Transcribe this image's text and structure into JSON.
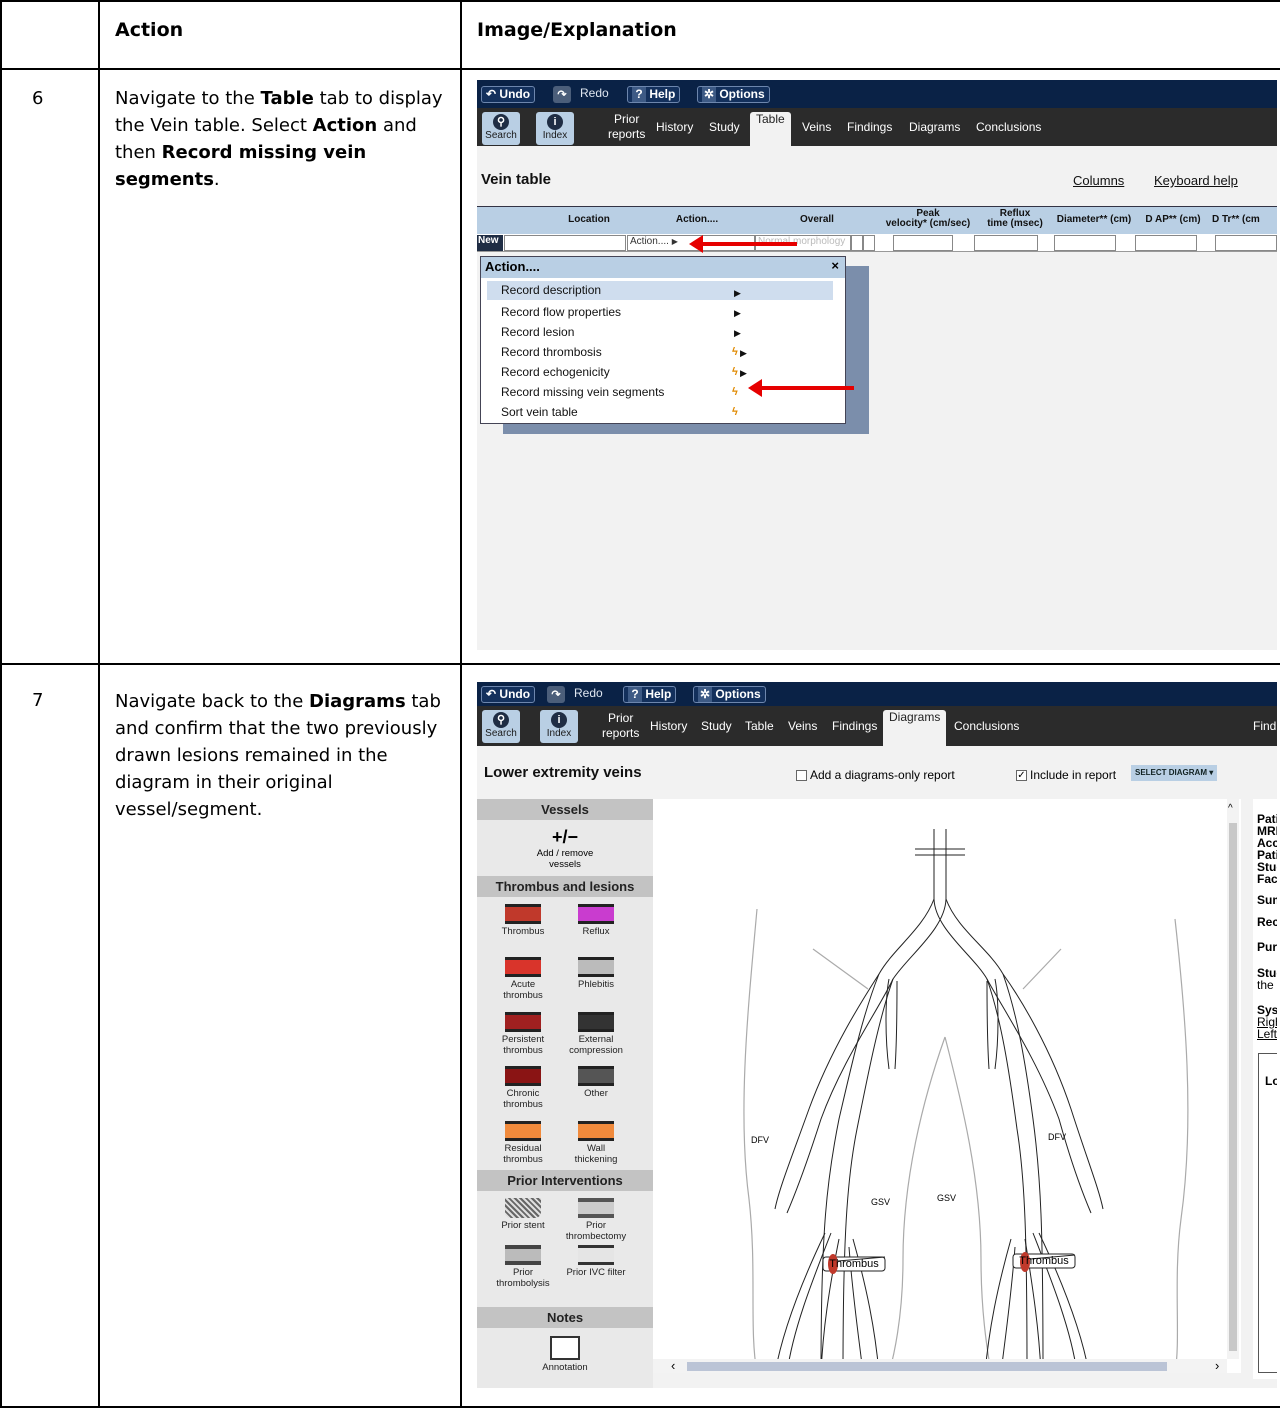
{
  "table_header": {
    "col_action": "Action",
    "col_image": "Image/Explanation"
  },
  "steps": [
    {
      "number": "6",
      "description_parts": [
        "Navigate to the ",
        "Table",
        " tab to display the Vein table. Select ",
        "Action",
        " and then ",
        "Record missing vein segments",
        "."
      ]
    },
    {
      "number": "7",
      "description_parts": [
        "Navigate back to the ",
        "Diagrams",
        " tab and confirm that the two previously drawn lesions remained in the diagram in their original vessel/segment."
      ]
    }
  ],
  "toolbar": {
    "undo": "Undo",
    "redo": "Redo",
    "help": "Help",
    "options": "Options"
  },
  "nav": {
    "search": "Search",
    "index": "Index",
    "prior_reports": "Prior\nreports",
    "history": "History",
    "study": "Study",
    "table": "Table",
    "veins": "Veins",
    "findings": "Findings",
    "diagrams": "Diagrams",
    "conclusions": "Conclusions",
    "find_cut": "Find"
  },
  "vein_table": {
    "title": "Vein table",
    "columns_link": "Columns",
    "keyboard_help_link": "Keyboard help",
    "headers": [
      "Location",
      "Action....",
      "Overall",
      "Peak\nvelocity* (cm/sec)",
      "Reflux\ntime (msec)",
      "Diameter** (cm)",
      "D AP** (cm)",
      "D Tr** (cm"
    ],
    "new_row_label": "New",
    "action_cell": "Action....",
    "overall_cell": "Normal morphology"
  },
  "action_menu": {
    "title": "Action....",
    "close": "×",
    "items": [
      "Record description",
      "Record flow properties",
      "Record lesion",
      "Record thrombosis",
      "Record echogenicity",
      "Record missing vein segments",
      "Sort vein table"
    ]
  },
  "diagram_view": {
    "title": "Lower extremity veins",
    "diagrams_only_label": "Add a diagrams-only report",
    "include_label": "Include in report",
    "select_diagram": "SELECT DIAGRAM ▾",
    "sections": {
      "vessels": "Vessels",
      "thrombus": "Thrombus and lesions",
      "prior": "Prior Interventions",
      "notes": "Notes"
    },
    "add_remove": "+/−",
    "add_remove_label": "Add / remove\nvessels",
    "lesion_tools": [
      {
        "label": "Thrombus",
        "color": "#c0392b"
      },
      {
        "label": "Reflux",
        "color": "#c93ccf"
      },
      {
        "label": "Acute\nthrombus",
        "color": "#d9342b"
      },
      {
        "label": "Phlebitis",
        "color": "#bbbbbb"
      },
      {
        "label": "Persistent\nthrombus",
        "color": "#a02020"
      },
      {
        "label": "External\ncompression",
        "color": "#333333"
      },
      {
        "label": "Chronic\nthrombus",
        "color": "#8a1414"
      },
      {
        "label": "Other",
        "color": "#555555"
      },
      {
        "label": "Residual\nthrombus",
        "color": "#f08a3c"
      },
      {
        "label": "Wall\nthickening",
        "color": "#f08a3c"
      }
    ],
    "prior_tools": [
      "Prior stent",
      "Prior\nthrombectomy",
      "Prior\nthrombolysis",
      "Prior IVC filter"
    ],
    "annotation": "Annotation",
    "vessel_labels": {
      "dfv_left": "DFV",
      "dfv_right": "DFV",
      "gsv_left": "GSV",
      "gsv_right": "GSV"
    },
    "lesion_labels": [
      "Thrombus",
      "Thrombus"
    ],
    "report_fragments": [
      "Patie",
      "MRN",
      "Acce",
      "Patie",
      "Stud",
      "Facil",
      "Sumi",
      "Reco",
      "Purp",
      "Stud",
      "the p",
      "Syst",
      "Right",
      "Left p",
      "Lo"
    ]
  }
}
